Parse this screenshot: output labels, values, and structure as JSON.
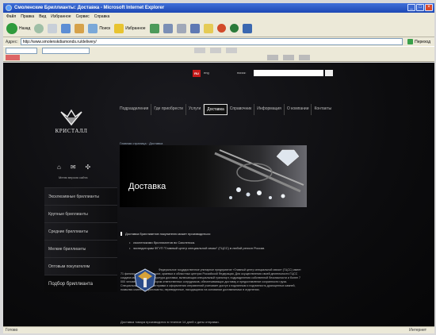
{
  "window": {
    "title": "Смоленские Бриллианты: Доставка - Microsoft Internet Explorer"
  },
  "menubar": [
    "Файл",
    "Правка",
    "Вид",
    "Избранное",
    "Сервис",
    "Справка"
  ],
  "toolbar": {
    "back_label": "Назад",
    "search_label": "Поиск",
    "favorites_label": "Избранное"
  },
  "address": {
    "label": "Адрес:",
    "url": "http://www.smolenskdiamonds.ru/delivery/",
    "go_label": "Переход"
  },
  "site": {
    "lang_ru": "RU",
    "lang_eng": "eng",
    "search_label": "поиск:",
    "logo_text": "КРИСТАЛЛ",
    "util_link": "Меню версия сайта",
    "nav": [
      "Подразделения",
      "Где приобрести",
      "Услуги",
      "Доставка",
      "Справочник",
      "Информация",
      "О компании",
      "Контакты"
    ],
    "sidebar": [
      "Эксклюзивные бриллианты",
      "Крупные бриллианты",
      "Средние бриллианты",
      "Мелкие бриллианты",
      "Оптовым покупателям",
      "Подбор бриллианта"
    ],
    "breadcrumb": "Главная страница · Доставка",
    "hero_title": "Доставка",
    "intro": "Доставка бриллиантов покупателю может производиться:",
    "bullets": [
      "смоленскими бриллиантов во Смоленска.",
      "экспедиторам ФГУП \"Главный центр специальной связи\" (ГЦСС) в любой регион России."
    ],
    "paragraph": "Федеральное государственное унитарное предприятие «Главный центр специальной связи» (ГЦСС) имеет 71 филиал в республиканских, краевых и областных центрах Российской Федерации. Для осуществления своей деятельности ГЦСС создана мощная инфраструктура доставки, включающая специальный транспорт, подразделения собственной безопасности и более 7 000 человек, с таким подбором ответственных сотрудников, обеспечивающих доставку и предоставление сохранности груза. Специальная процедура отправки и оформления отправлений учитывает доступ к подлинным и подлинность драгоценных камней, позволяя клиентам бриллианты, переведенные, находящиеся на основании доставляемых в отделении.",
    "footer_line": "Доставка товара производится в течение 14 дней с даты отправки."
  },
  "status": {
    "text": "Готово",
    "zone": "Интернет"
  }
}
